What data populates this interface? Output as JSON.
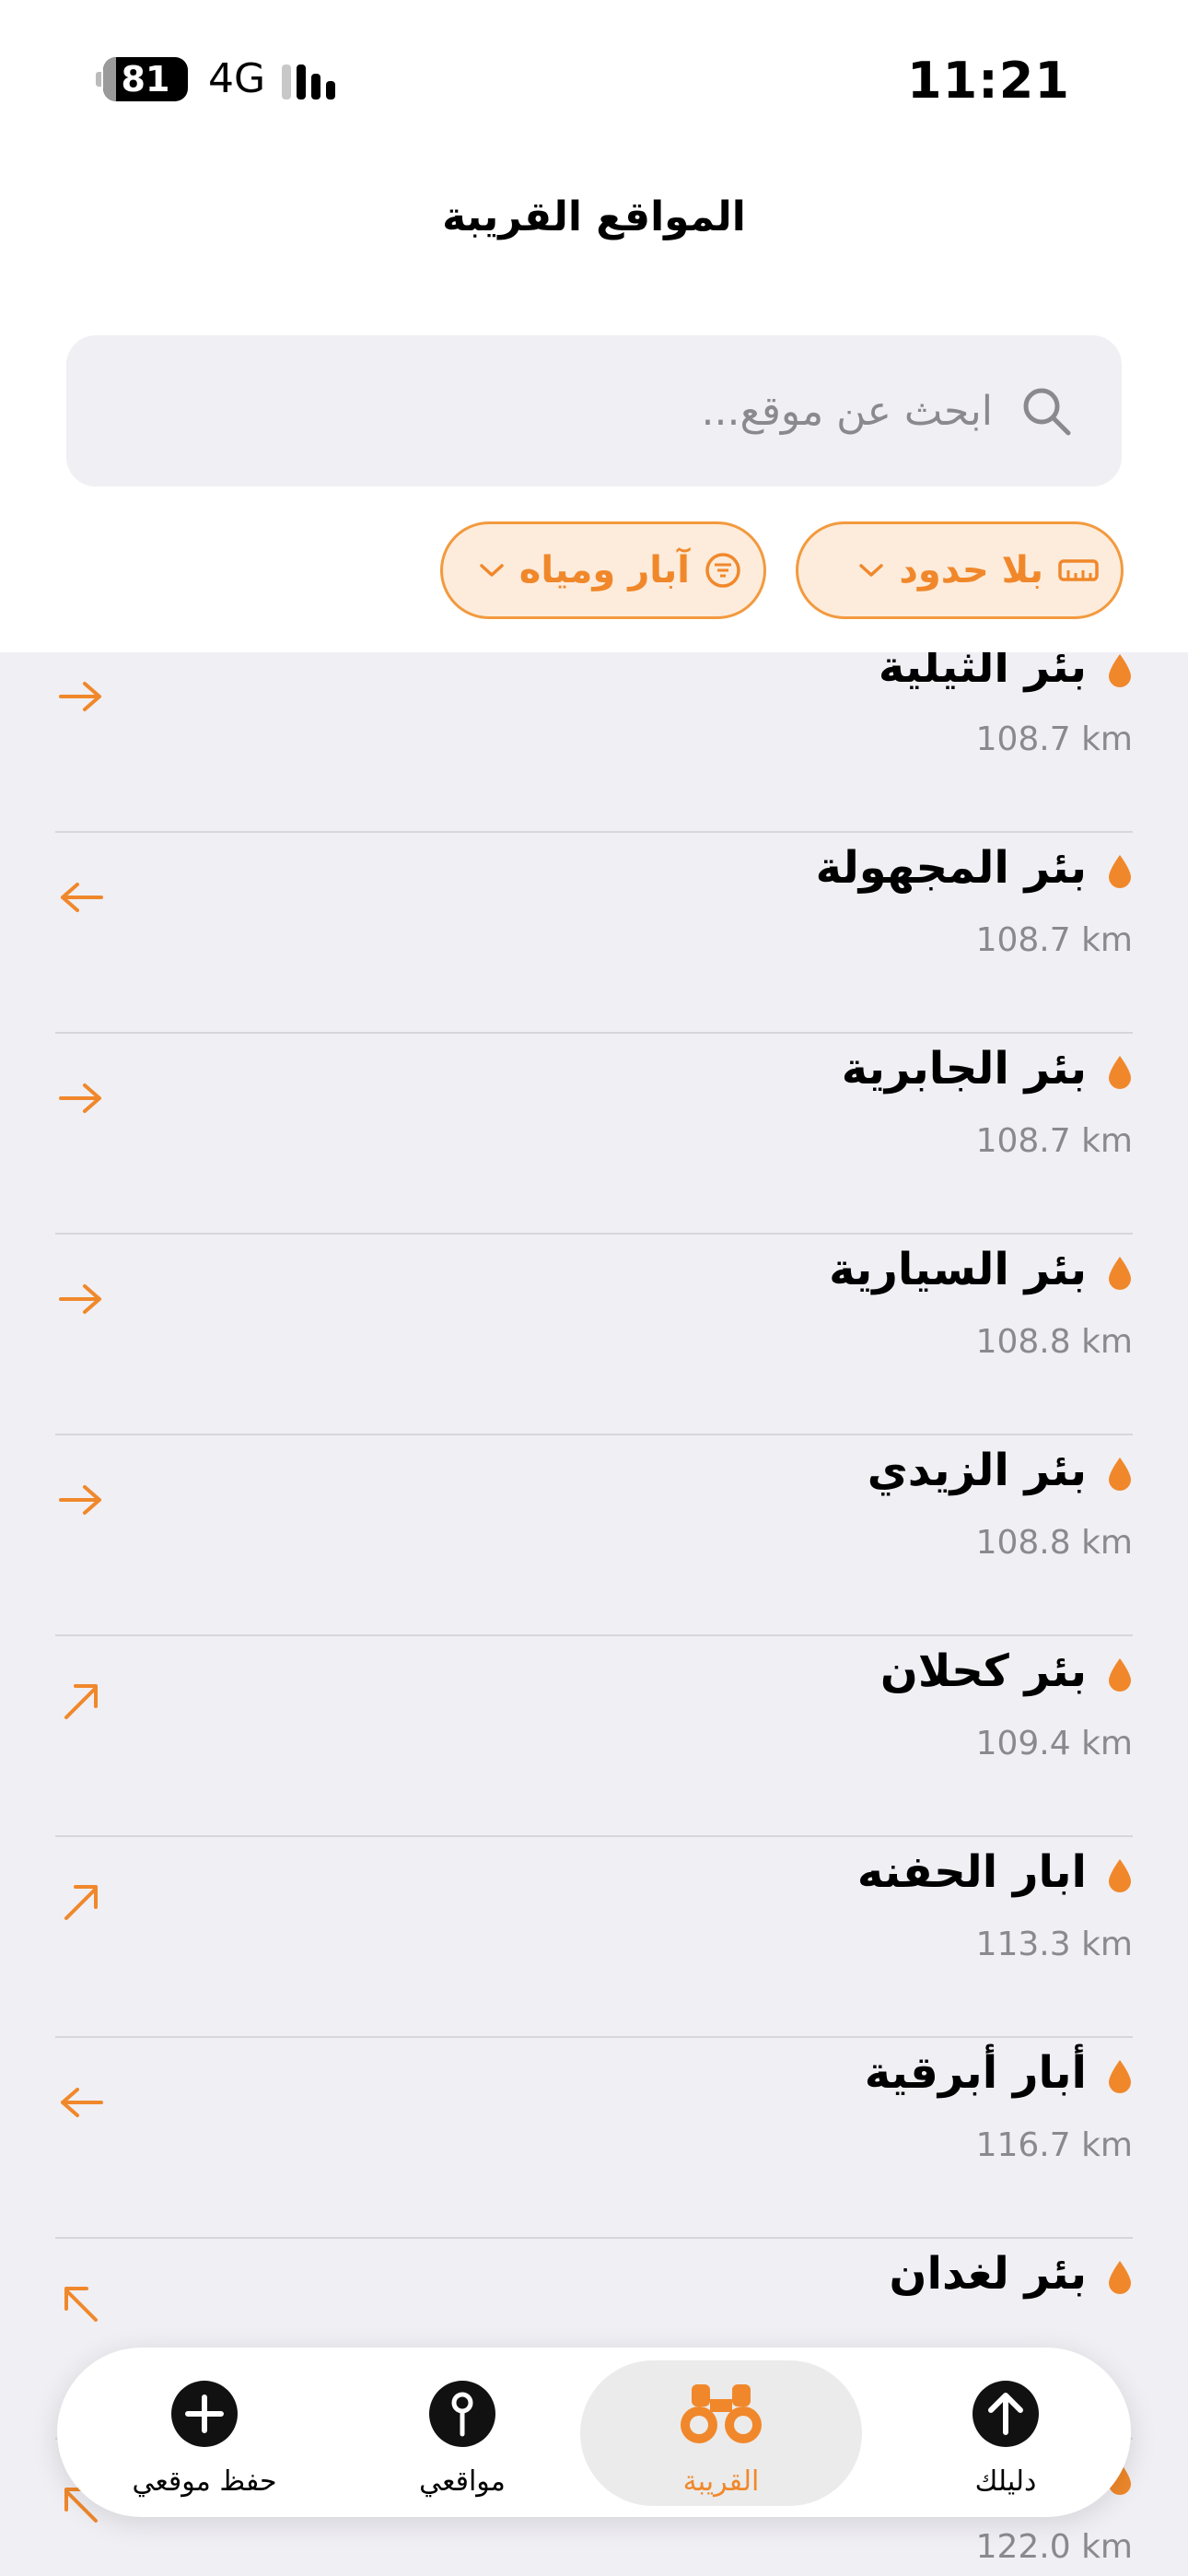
{
  "status_bar": {
    "battery": "81",
    "network": "4G",
    "time": "11:21"
  },
  "header": {
    "title": "المواقع القريبة"
  },
  "search": {
    "placeholder": "ابحث عن موقع..."
  },
  "filters": [
    {
      "label": "بلا حدود",
      "icon": "ruler-icon"
    },
    {
      "label": "آبار ومياه",
      "icon": "filter-icon"
    }
  ],
  "colors": {
    "accent": "#f0882b",
    "chip_bg": "#fdecdc",
    "list_bg": "#f0eff4"
  },
  "places": [
    {
      "name": "بئر الثيلية",
      "distance": "108.7 km",
      "arrow": "right"
    },
    {
      "name": "بئر المجهولة",
      "distance": "108.7 km",
      "arrow": "left"
    },
    {
      "name": "بئر الجابرية",
      "distance": "108.7 km",
      "arrow": "right"
    },
    {
      "name": "بئر السيارية",
      "distance": "108.8 km",
      "arrow": "right"
    },
    {
      "name": "بئر الزيدي",
      "distance": "108.8 km",
      "arrow": "right"
    },
    {
      "name": "بئر كحلان",
      "distance": "109.4 km",
      "arrow": "up-right"
    },
    {
      "name": "ابار الحفنه",
      "distance": "113.3 km",
      "arrow": "up-right"
    },
    {
      "name": "أبار أبرقية",
      "distance": "116.7 km",
      "arrow": "left"
    },
    {
      "name": "بئر لغدان",
      "distance": "",
      "arrow": "up-left"
    },
    {
      "name": "",
      "distance": "122.0 km",
      "arrow": "up-left"
    }
  ],
  "tabs": [
    {
      "label": "دليلك",
      "icon": "arrow-up-circle-icon"
    },
    {
      "label": "القريبة",
      "icon": "binoculars-icon",
      "active": true
    },
    {
      "label": "مواقعي",
      "icon": "pin-icon"
    },
    {
      "label": "حفظ موقعي",
      "icon": "plus-circle-icon"
    }
  ]
}
